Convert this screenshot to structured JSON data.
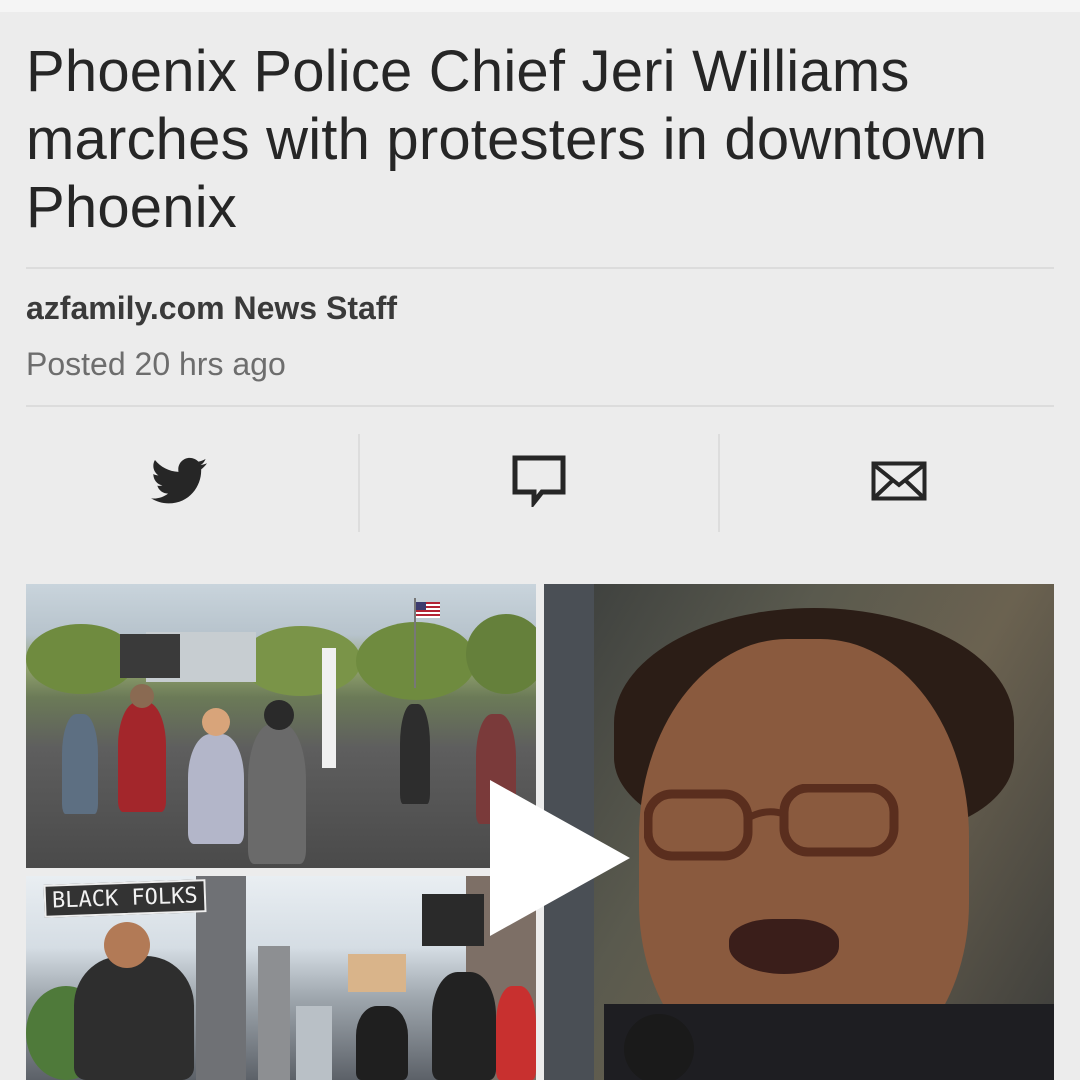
{
  "article": {
    "headline": "Phoenix Police Chief Jeri Williams marches with protesters in downtown Phoenix",
    "author": "azfamily.com News Staff",
    "posted": "Posted 20 hrs ago"
  },
  "share": {
    "buttons": [
      {
        "icon": "twitter-icon"
      },
      {
        "icon": "comment-icon"
      },
      {
        "icon": "email-icon"
      }
    ]
  },
  "media": {
    "sign_text": "BLACK FOLKS",
    "play_icon": "play-icon"
  },
  "colors": {
    "background": "#ececec",
    "text": "#262626",
    "muted": "#6d6d6d",
    "divider": "#dcdcdc"
  }
}
